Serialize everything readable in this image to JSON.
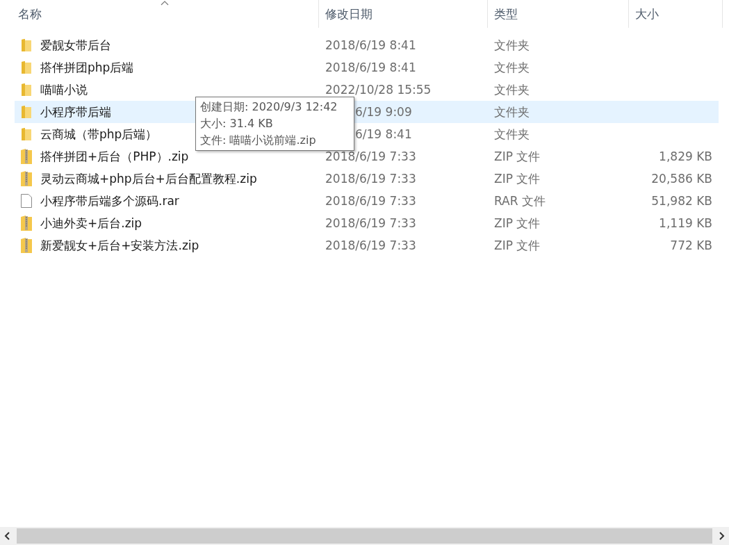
{
  "columns": [
    "名称",
    "修改日期",
    "类型",
    "大小"
  ],
  "files": [
    {
      "kind": "folder",
      "name": "爱靓女带后台",
      "date": "2018/6/19 8:41",
      "type": "文件夹",
      "selected": false
    },
    {
      "kind": "folder",
      "name": "搭伴拼团php后端",
      "date": "2018/6/19 8:41",
      "type": "文件夹",
      "selected": false
    },
    {
      "kind": "folder",
      "name": "喵喵小说",
      "date": "2022/10/28 15:55",
      "type": "文件夹",
      "selected": false
    },
    {
      "kind": "folder",
      "name": "小程序带后端",
      "date": "6/19 9:09",
      "date_partly_hidden": true,
      "type": "文件夹",
      "selected": true
    },
    {
      "kind": "folder",
      "name": "云商城（带php后端）",
      "date": "6/19 8:41",
      "date_partly_hidden": true,
      "type": "文件夹",
      "selected": false
    },
    {
      "kind": "zip",
      "name": "搭伴拼团+后台（PHP）.zip",
      "date": "2018/6/19 7:33",
      "type": "ZIP 文件",
      "size": "1,829 KB",
      "selected": false
    },
    {
      "kind": "zip",
      "name": "灵动云商城+php后台+后台配置教程.zip",
      "date": "2018/6/19 7:33",
      "type": "ZIP 文件",
      "size": "20,586 KB",
      "selected": false
    },
    {
      "kind": "file",
      "name": "小程序带后端多个源码.rar",
      "date": "2018/6/19 7:33",
      "type": "RAR 文件",
      "size": "51,982 KB",
      "selected": false
    },
    {
      "kind": "zip",
      "name": "小迪外卖+后台.zip",
      "date": "2018/6/19 7:33",
      "type": "ZIP 文件",
      "size": "1,119 KB",
      "selected": false
    },
    {
      "kind": "zip",
      "name": "新爱靓女+后台+安装方法.zip",
      "date": "2018/6/19 7:33",
      "type": "ZIP 文件",
      "size": "772 KB",
      "selected": false
    }
  ],
  "tooltip": {
    "lines": [
      "创建日期: 2020/9/3 12:42",
      "大小: 31.4 KB",
      "文件: 喵喵小说前端.zip"
    ]
  }
}
